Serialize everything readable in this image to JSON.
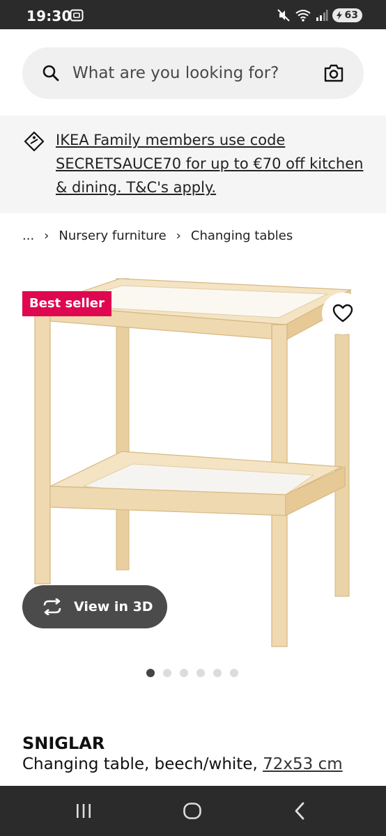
{
  "status_bar": {
    "time": "19:30",
    "battery": "63",
    "icons": [
      "screenshot-icon",
      "mute-icon",
      "wifi-icon",
      "signal-icon",
      "battery-icon"
    ]
  },
  "search": {
    "placeholder": "What are you looking for?",
    "value": "",
    "icons": [
      "search-icon",
      "camera-icon"
    ]
  },
  "promo": {
    "text": "IKEA Family members use code SECRETSAUCE70 for up to €70 off kitchen & dining. T&C's apply.",
    "icon": "tag-icon"
  },
  "breadcrumb": {
    "items": [
      "...",
      "Nursery furniture",
      "Changing tables"
    ]
  },
  "product": {
    "badge": "Best seller",
    "view_3d_label": "View in 3D",
    "image_count": 6,
    "active_image": 0,
    "name": "SNIGLAR",
    "description": "Changing table, beech/white,",
    "size": "72x53 cm"
  },
  "colors": {
    "badge": "#e00751",
    "wood": "#efd9b0",
    "status_bar": "#2b2b2b",
    "view_3d": "#4b4b4b"
  },
  "nav": {
    "icons": [
      "recent-apps-icon",
      "home-icon",
      "back-icon"
    ]
  }
}
